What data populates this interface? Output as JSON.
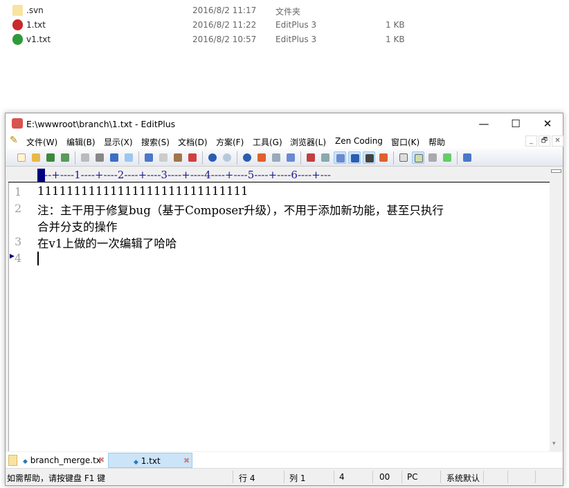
{
  "explorer": {
    "files": [
      {
        "name": ".svn",
        "date": "2016/8/2 11:17",
        "type": "文件夹",
        "size": "",
        "icon": "folder-icon"
      },
      {
        "name": "1.txt",
        "date": "2016/8/2 11:22",
        "type": "EditPlus 3",
        "size": "1 KB",
        "icon": "svn-conflict-file-icon"
      },
      {
        "name": "v1.txt",
        "date": "2016/8/2 10:57",
        "type": "EditPlus 3",
        "size": "1 KB",
        "icon": "svn-normal-file-icon"
      }
    ]
  },
  "window": {
    "title": "E:\\wwwroot\\branch\\1.txt - EditPlus",
    "minimize": "—",
    "maximize": "☐",
    "close": "✕"
  },
  "menu": [
    "文件(W)",
    "编辑(B)",
    "显示(X)",
    "搜索(S)",
    "文档(D)",
    "方案(F)",
    "工具(G)",
    "浏览器(L)",
    "Zen Coding",
    "窗口(K)",
    "帮助"
  ],
  "mdi": {
    "minimize": "_",
    "restore": "🗗",
    "close": "✕"
  },
  "ruler": "----+----1----+----2----+----3----+----4----+----5----+----6----+---",
  "editor": {
    "lines": [
      {
        "num": "1",
        "text": "11111111111111111111111111111"
      },
      {
        "num": "2",
        "text": "注：主干用于修复bug（基于Composer升级），不用于添加新功能，甚至只执行"
      },
      {
        "num": "",
        "text": "合并分支的操作"
      },
      {
        "num": "3",
        "text": "在v1上做的一次编辑了哈哈"
      },
      {
        "num": "4",
        "text": ""
      }
    ]
  },
  "tabs": [
    {
      "label": "branch_merge.tx",
      "active": false
    },
    {
      "label": "1.txt",
      "active": true
    }
  ],
  "status": {
    "help": "如需帮助，请按键盘 F1 键",
    "row": "行 4",
    "col": "列 1",
    "chars": "4",
    "code": "00",
    "eol": "PC",
    "encoding": "系统默认"
  },
  "colors": {
    "accent": "#cce4f7",
    "ruler": "#1a1a8c",
    "cursor": "#00007f"
  }
}
